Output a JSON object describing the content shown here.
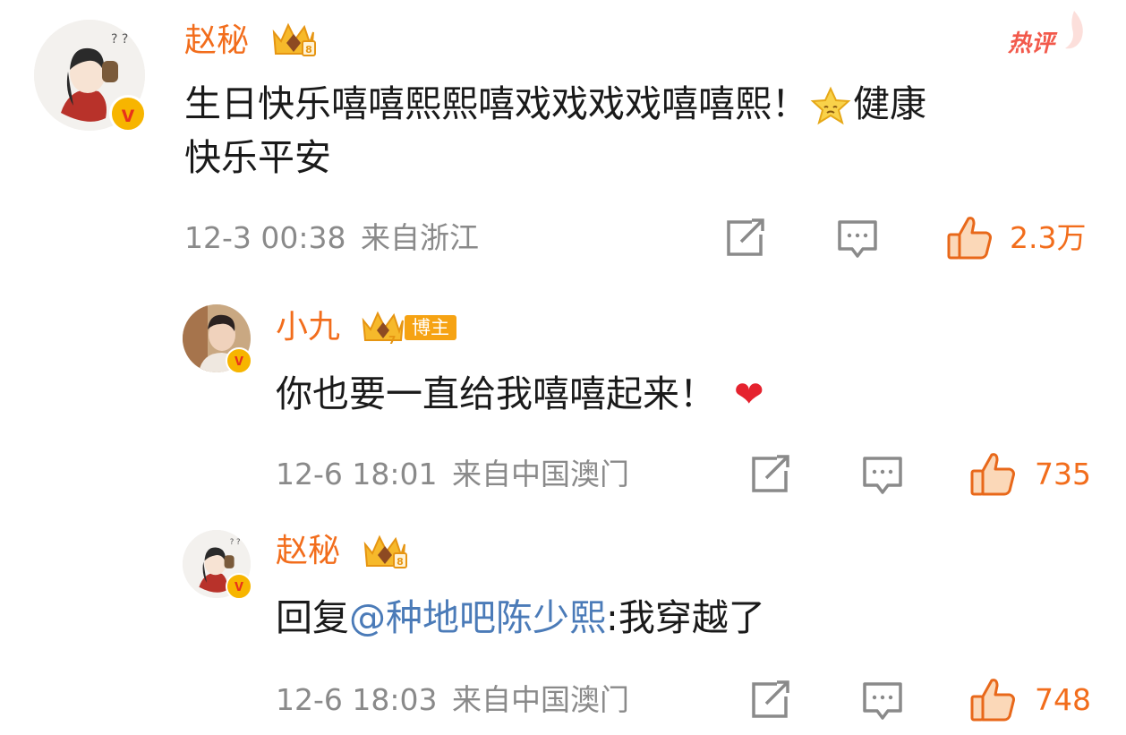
{
  "comment1": {
    "username": "赵秘",
    "hot_label": "热评",
    "text_line1": "生日快乐嘻嘻熙熙嘻戏戏戏戏嘻嘻熙！",
    "text_line1_suffix": "健康",
    "text_line2": "快乐平安",
    "timestamp": "12-3 00:38",
    "location": "来自浙江",
    "likes": "2.3万"
  },
  "reply1": {
    "username": "小九",
    "role_badge": "博主",
    "text": "你也要一直给我嘻嘻起来！",
    "emoji": "❤",
    "timestamp": "12-6 18:01",
    "location": "来自中国澳门",
    "likes": "735"
  },
  "reply2": {
    "username": "赵秘",
    "prefix": "回复",
    "mention": "@种地吧陈少熙",
    "text": ":我穿越了",
    "timestamp": "12-6 18:03",
    "location": "来自中国澳门",
    "likes": "748"
  },
  "colors": {
    "username": "#f26d1c",
    "mention": "#4b7bb8",
    "meta": "#8a8a8a",
    "hot": "#f2594b"
  },
  "icons": [
    "verified-icon",
    "crown-level-icon",
    "share-icon",
    "comment-icon",
    "like-icon",
    "star-emoji-icon",
    "heart-emoji-icon"
  ]
}
